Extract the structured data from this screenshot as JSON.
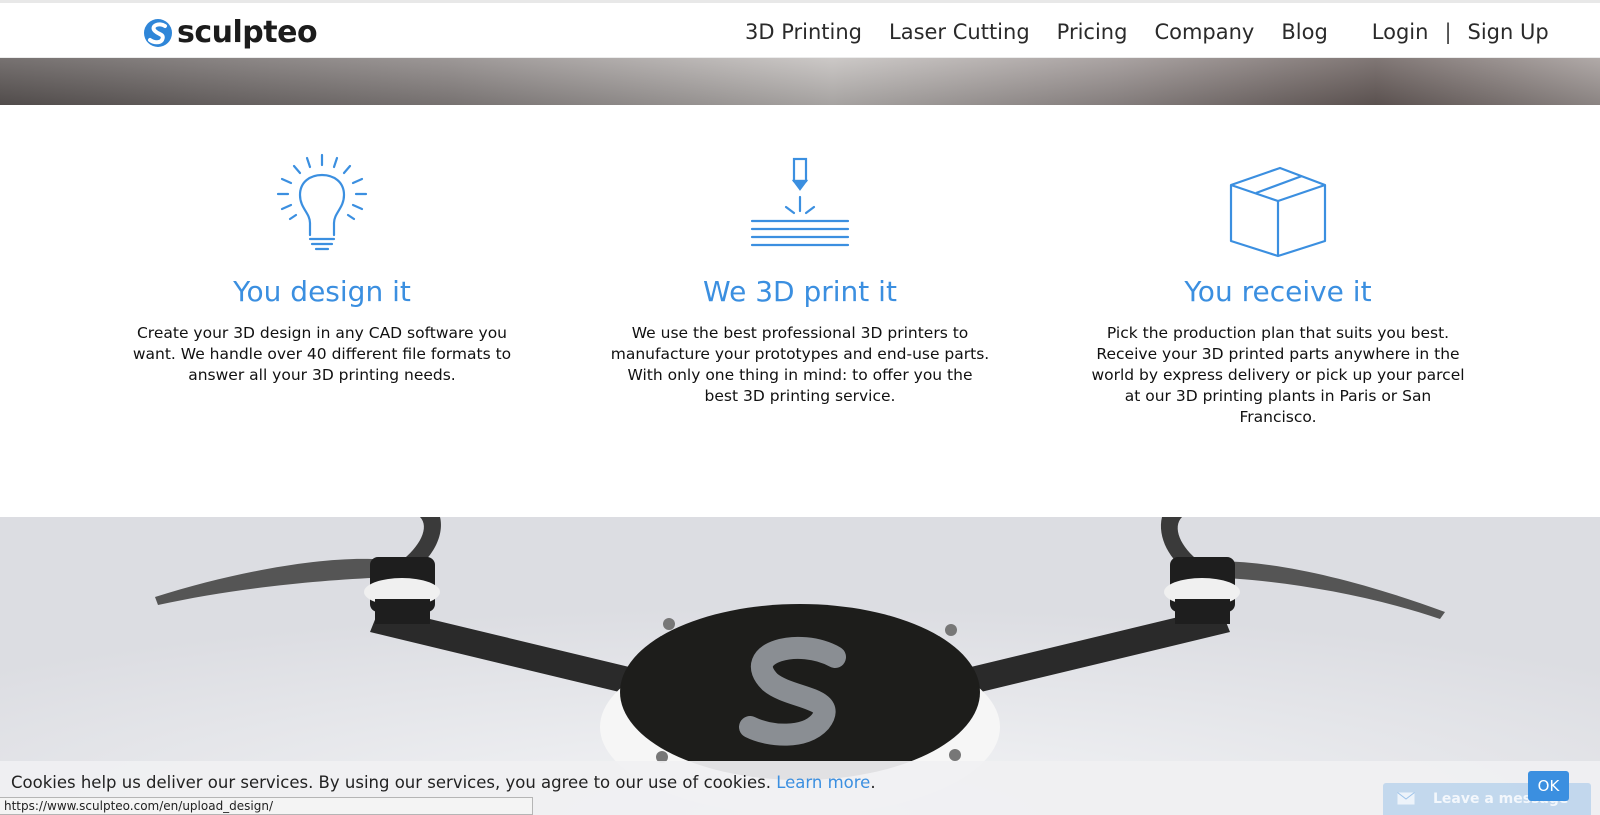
{
  "brand": {
    "name": "sculpteo"
  },
  "nav": {
    "items": [
      "3D Printing",
      "Laser Cutting",
      "Pricing",
      "Company",
      "Blog"
    ],
    "login": "Login",
    "separator": "|",
    "signup": "Sign Up"
  },
  "steps": [
    {
      "icon": "lightbulb-icon",
      "title": "You design it",
      "text": "Create your 3D design in any CAD software you want. We handle over 40 different file formats to answer all your 3D printing needs."
    },
    {
      "icon": "3d-printer-nozzle-icon",
      "title": "We 3D print it",
      "text": "We use the best professional 3D printers to manufacture your prototypes and end-use parts. With only one thing in mind: to offer you the best 3D printing service."
    },
    {
      "icon": "box-icon",
      "title": "You receive it",
      "text": "Pick the production plan that suits you best. Receive your 3D printed parts anywhere in the world by express delivery or pick up your parcel at our 3D printing plants in Paris or San Francisco."
    }
  ],
  "cookie": {
    "message": "Cookies help us deliver our services. By using our services, you agree to our use of cookies.",
    "link": "Learn more",
    "period": ".",
    "ok": "OK"
  },
  "chat": {
    "label": "Leave a message"
  },
  "status_bar": {
    "url": "https://www.sculpteo.com/en/upload_design/"
  },
  "colors": {
    "accent": "#3b8fe0",
    "text": "#111111"
  }
}
